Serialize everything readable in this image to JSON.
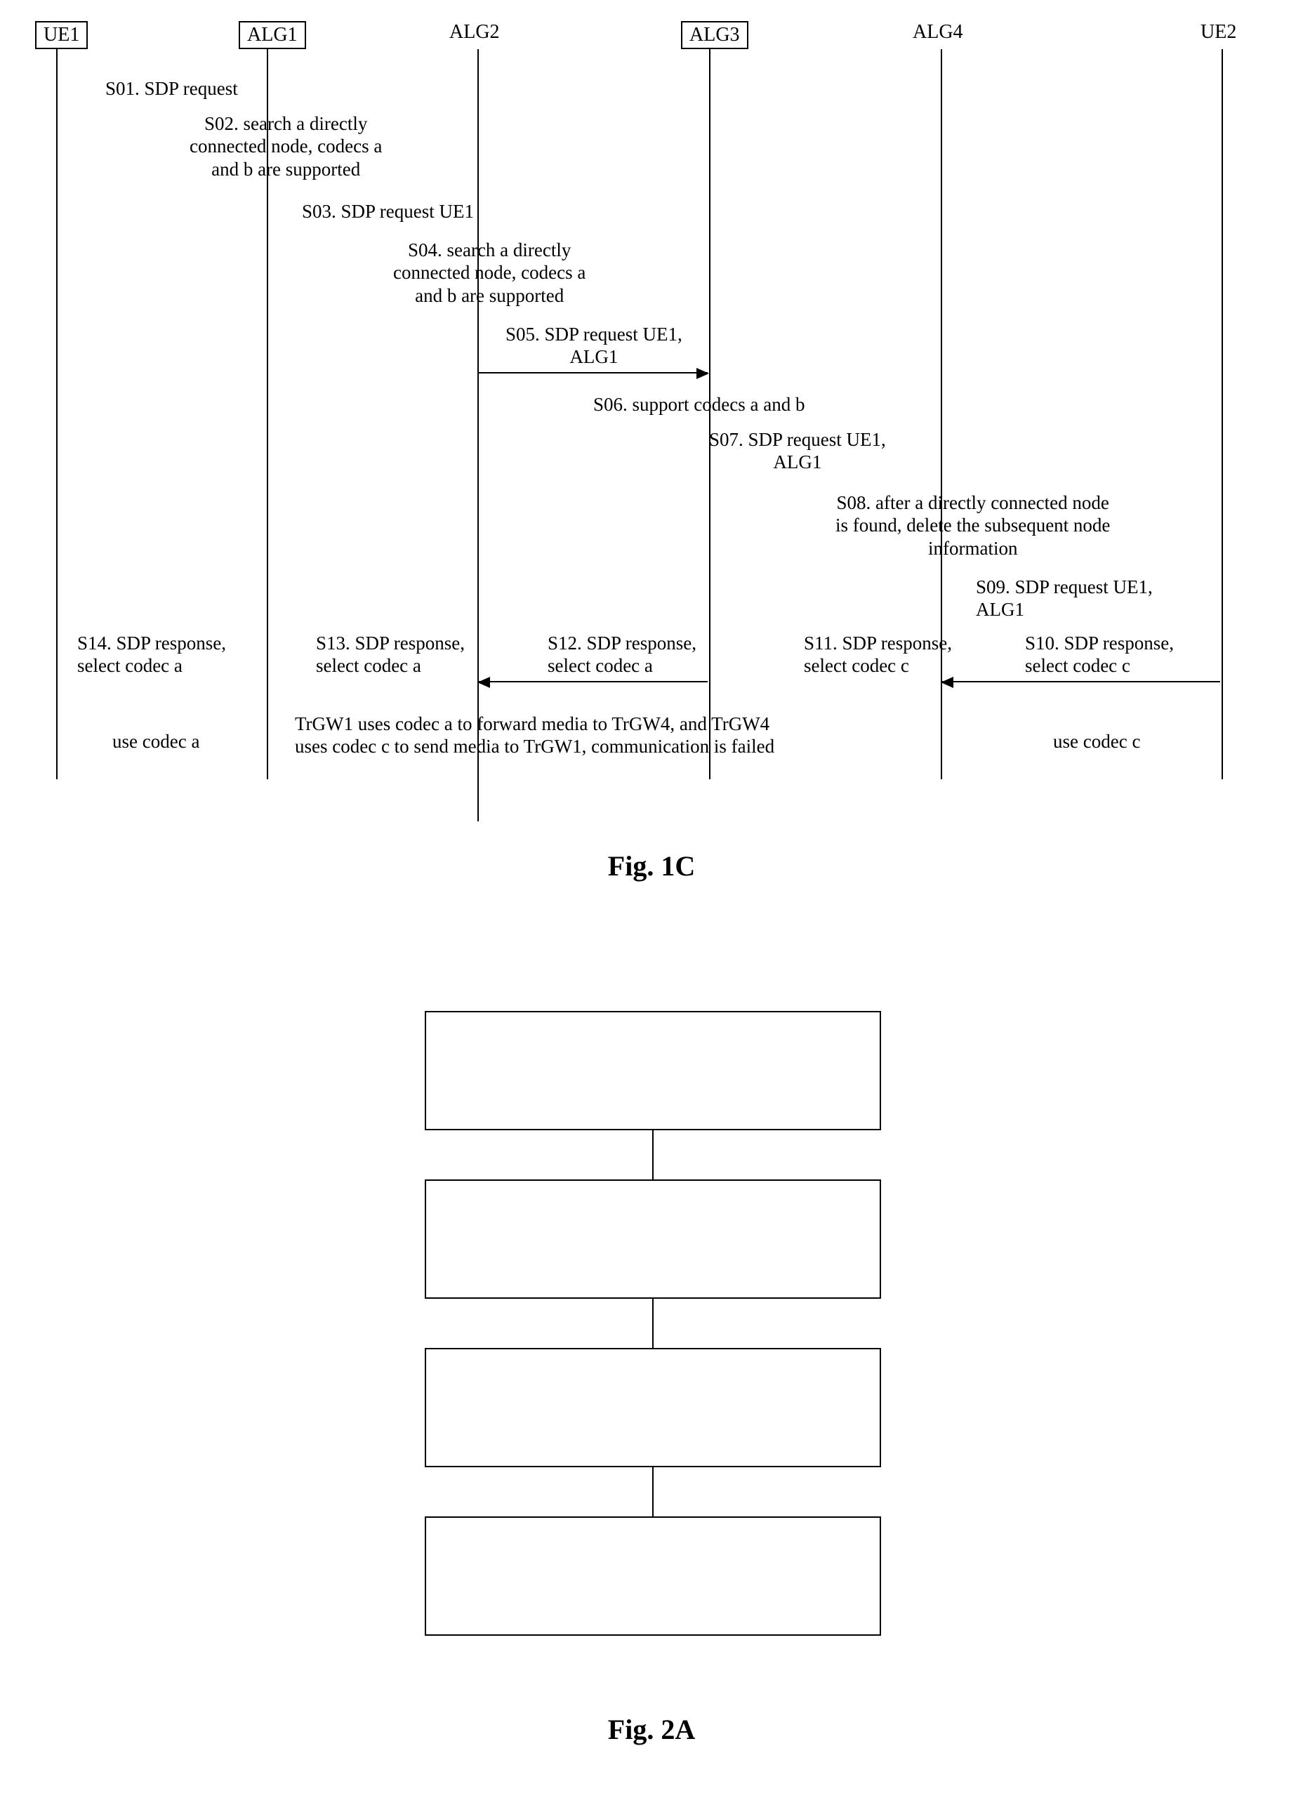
{
  "sequence": {
    "participants": {
      "ue1": "UE1",
      "alg1": "ALG1",
      "alg2": "ALG2",
      "alg3": "ALG3",
      "alg4": "ALG4",
      "ue2": "UE2"
    },
    "messages": {
      "s01": "S01. SDP request",
      "s02": "S02. search a directly\nconnected node, codecs a\nand b are supported",
      "s03": "S03. SDP request UE1",
      "s04": "S04. search a directly\nconnected node, codecs a\nand b are supported",
      "s05": "S05. SDP request UE1,\nALG1",
      "s06": "S06. support codecs a and b",
      "s07": "S07. SDP request UE1,\nALG1",
      "s08": "S08. after a directly connected node\nis found, delete the subsequent node\ninformation",
      "s09": "S09. SDP request UE1,\nALG1",
      "s10": "S10. SDP response,\nselect codec c",
      "s11": "S11. SDP response,\nselect codec c",
      "s12": "S12. SDP response,\nselect codec a",
      "s13": "S13. SDP response,\nselect codec a",
      "s14": "S14. SDP response,\nselect codec a",
      "use_a": "use codec a",
      "use_c": "use codec c",
      "fail": "TrGW1 uses codec a to forward media to TrGW4, and TrGW4\nuses codec c to send media to TrGW1, communication is failed"
    },
    "caption": "Fig. 1C"
  },
  "flowchart": {
    "caption": "Fig. 2A"
  }
}
